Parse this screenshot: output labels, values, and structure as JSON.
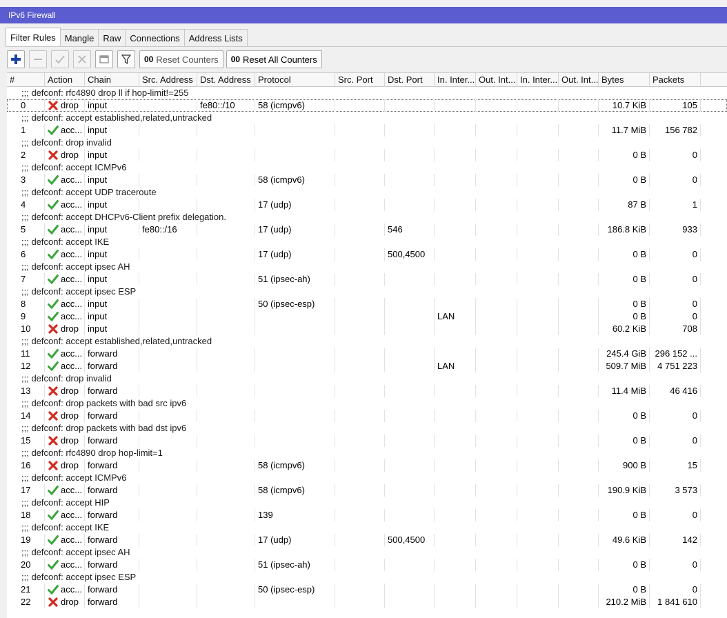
{
  "window": {
    "title": "IPv6 Firewall"
  },
  "tabs": [
    {
      "label": "Filter Rules",
      "active": true
    },
    {
      "label": "Mangle"
    },
    {
      "label": "Raw"
    },
    {
      "label": "Connections"
    },
    {
      "label": "Address Lists"
    }
  ],
  "toolbar": {
    "add_icon": "plus-icon",
    "remove_icon": "minus-icon",
    "enable_icon": "check-icon",
    "disable_icon": "x-icon",
    "comment_icon": "note-icon",
    "filter_icon": "filter-icon",
    "reset_counters_prefix": "00",
    "reset_counters_label": "Reset Counters",
    "reset_all_counters_prefix": "00",
    "reset_all_counters_label": "Reset All Counters"
  },
  "columns": [
    "#",
    "Action",
    "Chain",
    "Src. Address",
    "Dst. Address",
    "Protocol",
    "Src. Port",
    "Dst. Port",
    "In. Inter...",
    "Out. Int...",
    "In. Inter...",
    "Out. Int...",
    "Bytes",
    "Packets"
  ],
  "colors": {
    "title_bar": "#5a5ccf",
    "accept_icon": "#3aa53a",
    "drop_icon": "#d42a1e",
    "add_icon": "#1d3fa8"
  },
  "rows": [
    {
      "type": "comment",
      "text": ";;; defconf: rfc4890 drop ll if hop-limit!=255"
    },
    {
      "type": "rule",
      "selected": true,
      "num": "0",
      "action": "drop",
      "action_label": "drop",
      "chain": "input",
      "src": "",
      "dst": "fe80::/10",
      "protocol": "58 (icmpv6)",
      "sport": "",
      "dport": "",
      "in_if": "",
      "out_if": "",
      "in_if2": "",
      "out_if2": "",
      "bytes": "10.7 KiB",
      "packets": "105"
    },
    {
      "type": "comment",
      "text": ";;; defconf: accept established,related,untracked"
    },
    {
      "type": "rule",
      "num": "1",
      "action": "accept",
      "action_label": "acc...",
      "chain": "input",
      "src": "",
      "dst": "",
      "protocol": "",
      "sport": "",
      "dport": "",
      "in_if": "",
      "out_if": "",
      "in_if2": "",
      "out_if2": "",
      "bytes": "11.7 MiB",
      "packets": "156 782"
    },
    {
      "type": "comment",
      "text": ";;; defconf: drop invalid"
    },
    {
      "type": "rule",
      "num": "2",
      "action": "drop",
      "action_label": "drop",
      "chain": "input",
      "src": "",
      "dst": "",
      "protocol": "",
      "sport": "",
      "dport": "",
      "in_if": "",
      "out_if": "",
      "in_if2": "",
      "out_if2": "",
      "bytes": "0 B",
      "packets": "0"
    },
    {
      "type": "comment",
      "text": ";;; defconf: accept ICMPv6"
    },
    {
      "type": "rule",
      "num": "3",
      "action": "accept",
      "action_label": "acc...",
      "chain": "input",
      "src": "",
      "dst": "",
      "protocol": "58 (icmpv6)",
      "sport": "",
      "dport": "",
      "in_if": "",
      "out_if": "",
      "in_if2": "",
      "out_if2": "",
      "bytes": "0 B",
      "packets": "0"
    },
    {
      "type": "comment",
      "text": ";;; defconf: accept UDP traceroute"
    },
    {
      "type": "rule",
      "num": "4",
      "action": "accept",
      "action_label": "acc...",
      "chain": "input",
      "src": "",
      "dst": "",
      "protocol": "17 (udp)",
      "sport": "",
      "dport": "",
      "in_if": "",
      "out_if": "",
      "in_if2": "",
      "out_if2": "",
      "bytes": "87 B",
      "packets": "1"
    },
    {
      "type": "comment",
      "text": ";;; defconf: accept DHCPv6-Client prefix delegation."
    },
    {
      "type": "rule",
      "num": "5",
      "action": "accept",
      "action_label": "acc...",
      "chain": "input",
      "src": "fe80::/16",
      "dst": "",
      "protocol": "17 (udp)",
      "sport": "",
      "dport": "546",
      "in_if": "",
      "out_if": "",
      "in_if2": "",
      "out_if2": "",
      "bytes": "186.8 KiB",
      "packets": "933"
    },
    {
      "type": "comment",
      "text": ";;; defconf: accept IKE"
    },
    {
      "type": "rule",
      "num": "6",
      "action": "accept",
      "action_label": "acc...",
      "chain": "input",
      "src": "",
      "dst": "",
      "protocol": "17 (udp)",
      "sport": "",
      "dport": "500,4500",
      "in_if": "",
      "out_if": "",
      "in_if2": "",
      "out_if2": "",
      "bytes": "0 B",
      "packets": "0"
    },
    {
      "type": "comment",
      "text": ";;; defconf: accept ipsec AH"
    },
    {
      "type": "rule",
      "num": "7",
      "action": "accept",
      "action_label": "acc...",
      "chain": "input",
      "src": "",
      "dst": "",
      "protocol": "51 (ipsec-ah)",
      "sport": "",
      "dport": "",
      "in_if": "",
      "out_if": "",
      "in_if2": "",
      "out_if2": "",
      "bytes": "0 B",
      "packets": "0"
    },
    {
      "type": "comment",
      "text": ";;; defconf: accept ipsec ESP"
    },
    {
      "type": "rule",
      "num": "8",
      "action": "accept",
      "action_label": "acc...",
      "chain": "input",
      "src": "",
      "dst": "",
      "protocol": "50 (ipsec-esp)",
      "sport": "",
      "dport": "",
      "in_if": "",
      "out_if": "",
      "in_if2": "",
      "out_if2": "",
      "bytes": "0 B",
      "packets": "0"
    },
    {
      "type": "rule",
      "num": "9",
      "action": "accept",
      "action_label": "acc...",
      "chain": "input",
      "src": "",
      "dst": "",
      "protocol": "",
      "sport": "",
      "dport": "",
      "in_if": "LAN",
      "out_if": "",
      "in_if2": "",
      "out_if2": "",
      "bytes": "0 B",
      "packets": "0"
    },
    {
      "type": "rule",
      "num": "10",
      "action": "drop",
      "action_label": "drop",
      "chain": "input",
      "src": "",
      "dst": "",
      "protocol": "",
      "sport": "",
      "dport": "",
      "in_if": "",
      "out_if": "",
      "in_if2": "",
      "out_if2": "",
      "bytes": "60.2 KiB",
      "packets": "708"
    },
    {
      "type": "comment",
      "text": ";;; defconf: accept established,related,untracked"
    },
    {
      "type": "rule",
      "num": "11",
      "action": "accept",
      "action_label": "acc...",
      "chain": "forward",
      "src": "",
      "dst": "",
      "protocol": "",
      "sport": "",
      "dport": "",
      "in_if": "",
      "out_if": "",
      "in_if2": "",
      "out_if2": "",
      "bytes": "245.4 GiB",
      "packets": "296 152 ..."
    },
    {
      "type": "rule",
      "num": "12",
      "action": "accept",
      "action_label": "acc...",
      "chain": "forward",
      "src": "",
      "dst": "",
      "protocol": "",
      "sport": "",
      "dport": "",
      "in_if": "LAN",
      "out_if": "",
      "in_if2": "",
      "out_if2": "",
      "bytes": "509.7 MiB",
      "packets": "4 751 223"
    },
    {
      "type": "comment",
      "text": ";;; defconf: drop invalid"
    },
    {
      "type": "rule",
      "num": "13",
      "action": "drop",
      "action_label": "drop",
      "chain": "forward",
      "src": "",
      "dst": "",
      "protocol": "",
      "sport": "",
      "dport": "",
      "in_if": "",
      "out_if": "",
      "in_if2": "",
      "out_if2": "",
      "bytes": "11.4 MiB",
      "packets": "46 416"
    },
    {
      "type": "comment",
      "text": ";;; defconf: drop packets with bad src ipv6"
    },
    {
      "type": "rule",
      "num": "14",
      "action": "drop",
      "action_label": "drop",
      "chain": "forward",
      "src": "",
      "dst": "",
      "protocol": "",
      "sport": "",
      "dport": "",
      "in_if": "",
      "out_if": "",
      "in_if2": "",
      "out_if2": "",
      "bytes": "0 B",
      "packets": "0"
    },
    {
      "type": "comment",
      "text": ";;; defconf: drop packets with bad dst ipv6"
    },
    {
      "type": "rule",
      "num": "15",
      "action": "drop",
      "action_label": "drop",
      "chain": "forward",
      "src": "",
      "dst": "",
      "protocol": "",
      "sport": "",
      "dport": "",
      "in_if": "",
      "out_if": "",
      "in_if2": "",
      "out_if2": "",
      "bytes": "0 B",
      "packets": "0"
    },
    {
      "type": "comment",
      "text": ";;; defconf: rfc4890 drop hop-limit=1"
    },
    {
      "type": "rule",
      "num": "16",
      "action": "drop",
      "action_label": "drop",
      "chain": "forward",
      "src": "",
      "dst": "",
      "protocol": "58 (icmpv6)",
      "sport": "",
      "dport": "",
      "in_if": "",
      "out_if": "",
      "in_if2": "",
      "out_if2": "",
      "bytes": "900 B",
      "packets": "15"
    },
    {
      "type": "comment",
      "text": ";;; defconf: accept ICMPv6"
    },
    {
      "type": "rule",
      "num": "17",
      "action": "accept",
      "action_label": "acc...",
      "chain": "forward",
      "src": "",
      "dst": "",
      "protocol": "58 (icmpv6)",
      "sport": "",
      "dport": "",
      "in_if": "",
      "out_if": "",
      "in_if2": "",
      "out_if2": "",
      "bytes": "190.9 KiB",
      "packets": "3 573"
    },
    {
      "type": "comment",
      "text": ";;; defconf: accept HIP"
    },
    {
      "type": "rule",
      "num": "18",
      "action": "accept",
      "action_label": "acc...",
      "chain": "forward",
      "src": "",
      "dst": "",
      "protocol": "139",
      "sport": "",
      "dport": "",
      "in_if": "",
      "out_if": "",
      "in_if2": "",
      "out_if2": "",
      "bytes": "0 B",
      "packets": "0"
    },
    {
      "type": "comment",
      "text": ";;; defconf: accept IKE"
    },
    {
      "type": "rule",
      "num": "19",
      "action": "accept",
      "action_label": "acc...",
      "chain": "forward",
      "src": "",
      "dst": "",
      "protocol": "17 (udp)",
      "sport": "",
      "dport": "500,4500",
      "in_if": "",
      "out_if": "",
      "in_if2": "",
      "out_if2": "",
      "bytes": "49.6 KiB",
      "packets": "142"
    },
    {
      "type": "comment",
      "text": ";;; defconf: accept ipsec AH"
    },
    {
      "type": "rule",
      "num": "20",
      "action": "accept",
      "action_label": "acc...",
      "chain": "forward",
      "src": "",
      "dst": "",
      "protocol": "51 (ipsec-ah)",
      "sport": "",
      "dport": "",
      "in_if": "",
      "out_if": "",
      "in_if2": "",
      "out_if2": "",
      "bytes": "0 B",
      "packets": "0"
    },
    {
      "type": "comment",
      "text": ";;; defconf: accept ipsec ESP"
    },
    {
      "type": "rule",
      "num": "21",
      "action": "accept",
      "action_label": "acc...",
      "chain": "forward",
      "src": "",
      "dst": "",
      "protocol": "50 (ipsec-esp)",
      "sport": "",
      "dport": "",
      "in_if": "",
      "out_if": "",
      "in_if2": "",
      "out_if2": "",
      "bytes": "0 B",
      "packets": "0"
    },
    {
      "type": "rule",
      "num": "22",
      "action": "drop",
      "action_label": "drop",
      "chain": "forward",
      "src": "",
      "dst": "",
      "protocol": "",
      "sport": "",
      "dport": "",
      "in_if": "",
      "out_if": "",
      "in_if2": "",
      "out_if2": "",
      "bytes": "210.2 MiB",
      "packets": "1 841 610"
    }
  ]
}
